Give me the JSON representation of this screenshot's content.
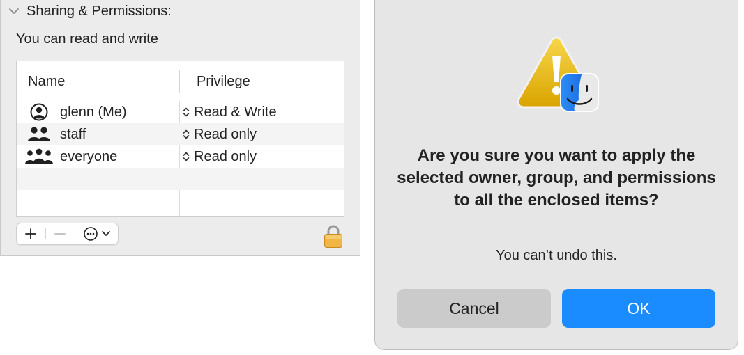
{
  "permissions_panel": {
    "section_title": "Sharing & Permissions:",
    "access_status": "You can read and write",
    "table": {
      "columns": [
        "Name",
        "Privilege"
      ],
      "rows": [
        {
          "name": "glenn (Me)",
          "privilege": "Read & Write",
          "icon": "user-circle-icon"
        },
        {
          "name": "staff",
          "privilege": "Read only",
          "icon": "group-icon"
        },
        {
          "name": "everyone",
          "privilege": "Read only",
          "icon": "everyone-icon"
        }
      ]
    },
    "toolbar": {
      "add_icon": "plus-icon",
      "remove_icon": "minus-icon",
      "actions_icon": "ellipsis-circle-icon"
    },
    "lock_icon": "lock-icon"
  },
  "alert_dialog": {
    "icon": "caution-with-finder-icon",
    "title": "Are you sure you want to apply the selected owner, group, and permissions to all the enclosed items?",
    "message": "You can’t undo this.",
    "cancel_label": "Cancel",
    "ok_label": "OK",
    "ok_color": "#1a8cff"
  }
}
